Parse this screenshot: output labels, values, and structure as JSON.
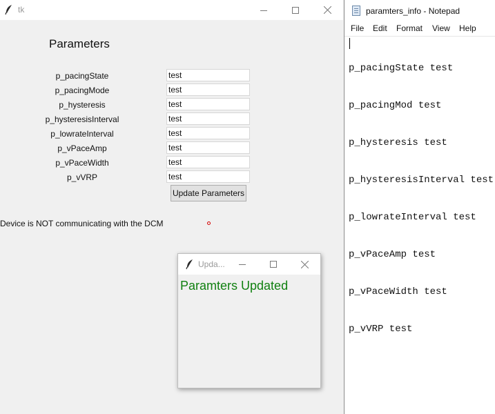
{
  "tk_window": {
    "title": "tk",
    "heading": "Parameters",
    "params": [
      {
        "label": "p_pacingState",
        "value": "test"
      },
      {
        "label": "p_pacingMode",
        "value": "test"
      },
      {
        "label": "p_hysteresis",
        "value": "test"
      },
      {
        "label": "p_hysteresisInterval",
        "value": "test"
      },
      {
        "label": "p_lowrateInterval",
        "value": "test"
      },
      {
        "label": "p_vPaceAmp",
        "value": "test"
      },
      {
        "label": "p_vPaceWidth",
        "value": "test"
      },
      {
        "label": "p_vVRP",
        "value": "test"
      }
    ],
    "update_button": "Update Parameters",
    "status_text": "Device is NOT communicating with the DCM",
    "status_indicator_color": "#d40000"
  },
  "popup": {
    "title": "Upda...",
    "message": "Paramters Updated",
    "message_color": "#108010"
  },
  "notepad": {
    "title": "paramters_info - Notepad",
    "menu": [
      "File",
      "Edit",
      "Format",
      "View",
      "Help"
    ],
    "lines": [
      "p_pacingState test",
      "p_pacingMod test",
      "p_hysteresis test",
      "p_hysteresisInterval test",
      "p_lowrateInterval test",
      "p_vPaceAmp test",
      "p_vPaceWidth test",
      "p_vVRP test"
    ]
  }
}
